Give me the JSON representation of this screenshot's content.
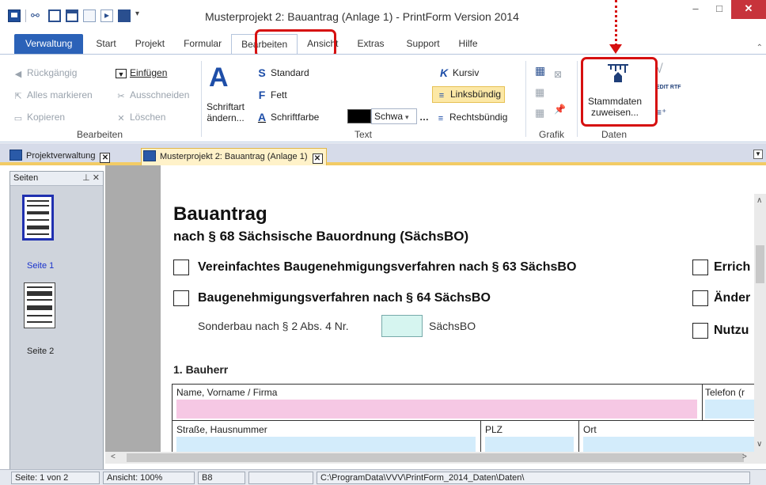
{
  "window": {
    "title": "Musterprojekt 2: Bauantrag (Anlage 1) - PrintForm Version 2014"
  },
  "ribbon_tabs": [
    "Verwaltung",
    "Start",
    "Projekt",
    "Formular",
    "Bearbeiten",
    "Ansicht",
    "Extras",
    "Support",
    "Hilfe"
  ],
  "bearbeiten": {
    "undo": "Rückgängig",
    "paste": "Einfügen",
    "select_all": "Alles markieren",
    "cut": "Ausschneiden",
    "copy": "Kopieren",
    "delete": "Löschen",
    "label": "Bearbeiten"
  },
  "text": {
    "font_change": "Schriftart ändern...",
    "standard": "Standard",
    "bold": "Fett",
    "font_color": "Schriftfarbe",
    "color_value": "Schwa",
    "italic": "Kursiv",
    "left_align": "Linksbündig",
    "right_align": "Rechtsbündig",
    "label": "Text"
  },
  "grafik": {
    "label": "Grafik"
  },
  "daten": {
    "stammdaten": "Stammdaten zuweisen...",
    "label": "Daten",
    "rtf_label": "EDIT RTF"
  },
  "doc_tabs": [
    "Projektverwaltung",
    "Musterprojekt 2: Bauantrag (Anlage 1)"
  ],
  "panel": {
    "title": "Seiten",
    "pages": [
      "Seite 1",
      "Seite 2"
    ]
  },
  "form": {
    "title": "Bauantrag",
    "subtitle": "nach § 68 Sächsische Bauordnung (SächsBO)",
    "opt1": "Vereinfachtes Baugenehmigungsverfahren nach § 63 SächsBO",
    "opt2": "Baugenehmigungsverfahren nach § 64 SächsBO",
    "sonderbau_prefix": "Sonderbau nach § 2 Abs. 4 Nr.",
    "sonderbau_suffix": "SächsBO",
    "right1": "Errich",
    "right2": "Änder",
    "right3": "Nutzu",
    "section": "1. Bauherr",
    "name_label": "Name, Vorname / Firma",
    "phone_label": "Telefon (r",
    "street_label": "Straße, Hausnummer",
    "plz_label": "PLZ",
    "ort_label": "Ort"
  },
  "status": {
    "page": "Seite: 1 von 2",
    "zoom": "Ansicht: 100%",
    "cell": "B8",
    "path": "C:\\ProgramData\\VVV\\PrintForm_2014_Daten\\Daten\\"
  }
}
